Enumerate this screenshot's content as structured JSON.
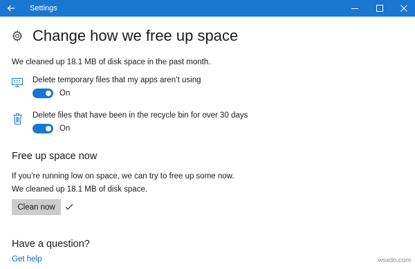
{
  "window": {
    "title": "Settings",
    "accent_color": "#1877d0"
  },
  "titlebar_icons": {
    "back": "back-arrow-icon",
    "minimize": "minimize-icon",
    "maximize": "maximize-icon",
    "close": "close-icon"
  },
  "header": {
    "icon": "gear-icon",
    "title": "Change how we free up space"
  },
  "status": {
    "cleaned_month": "We cleaned up 18.1 MB of disk space in the past month."
  },
  "options": [
    {
      "icon": "monitor-apps-icon",
      "label": "Delete temporary files that my apps aren’t using",
      "toggle_on": true,
      "state_label": "On"
    },
    {
      "icon": "recycle-bin-icon",
      "label": "Delete files that have been in the recycle bin for over 30 days",
      "toggle_on": true,
      "state_label": "On"
    }
  ],
  "free_up": {
    "heading": "Free up space now",
    "description": "If you’re running low on space, we can try to free up some now.",
    "result": "We cleaned up 18.1 MB of disk space.",
    "button_label": "Clean now",
    "done_icon": "checkmark-icon"
  },
  "question": {
    "heading": "Have a question?",
    "link": "Get help"
  },
  "watermark": "wsxdn.com"
}
